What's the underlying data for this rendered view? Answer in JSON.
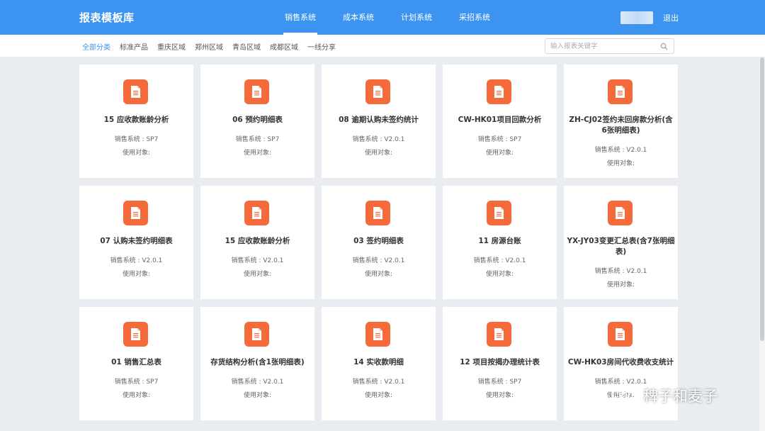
{
  "header": {
    "app_title": "报表模板库",
    "nav_tabs": [
      {
        "label": "销售系统",
        "active": true
      },
      {
        "label": "成本系统",
        "active": false
      },
      {
        "label": "计划系统",
        "active": false
      },
      {
        "label": "采招系统",
        "active": false
      }
    ],
    "logout_label": "退出"
  },
  "subnav": {
    "categories": [
      {
        "label": "全部分类",
        "active": true
      },
      {
        "label": "标准产品",
        "active": false
      },
      {
        "label": "重庆区域",
        "active": false
      },
      {
        "label": "郑州区域",
        "active": false
      },
      {
        "label": "青岛区域",
        "active": false
      },
      {
        "label": "成都区域",
        "active": false
      },
      {
        "label": "一线分享",
        "active": false
      }
    ],
    "search_placeholder": "输入报表关键字"
  },
  "cards": [
    {
      "title": "15 应收款账龄分析",
      "system": "销售系统 : SP7",
      "target": "使用对象:"
    },
    {
      "title": "06 预约明细表",
      "system": "销售系统 : SP7",
      "target": "使用对象:"
    },
    {
      "title": "08 逾期认购未签约统计",
      "system": "销售系统 : V2.0.1",
      "target": "使用对象:"
    },
    {
      "title": "CW-HK01项目回款分析",
      "system": "销售系统 : SP7",
      "target": "使用对象:"
    },
    {
      "title": "ZH-CJ02签约未回房款分析(含6张明细表)",
      "system": "销售系统 : V2.0.1",
      "target": "使用对象:"
    },
    {
      "title": "07 认购未签约明细表",
      "system": "销售系统 : V2.0.1",
      "target": "使用对象:"
    },
    {
      "title": "15 应收款账龄分析",
      "system": "销售系统 : V2.0.1",
      "target": "使用对象:"
    },
    {
      "title": "03 签约明细表",
      "system": "销售系统 : V2.0.1",
      "target": "使用对象:"
    },
    {
      "title": "11 房源台账",
      "system": "销售系统 : V2.0.1",
      "target": "使用对象:"
    },
    {
      "title": "YX-JY03变更汇总表(含7张明细表)",
      "system": "销售系统 : V2.0.1",
      "target": "使用对象:"
    },
    {
      "title": "01 销售汇总表",
      "system": "销售系统 : SP7",
      "target": "使用对象:"
    },
    {
      "title": "存货结构分析(含1张明细表)",
      "system": "销售系统 : V2.0.1",
      "target": "使用对象:"
    },
    {
      "title": "14 实收款明细",
      "system": "销售系统 : V2.0.1",
      "target": "使用对象:"
    },
    {
      "title": "12 项目按揭办理统计表",
      "system": "销售系统 : SP7",
      "target": "使用对象:"
    },
    {
      "title": "CW-HK03房间代收费收支统计",
      "system": "销售系统 : V2.0.1",
      "target": "使用对象:"
    }
  ],
  "watermark": {
    "text": "稗子和麦子"
  },
  "colors": {
    "primary": "#3c94f0",
    "icon": "#f56a3b",
    "background": "#e9ecf1"
  }
}
